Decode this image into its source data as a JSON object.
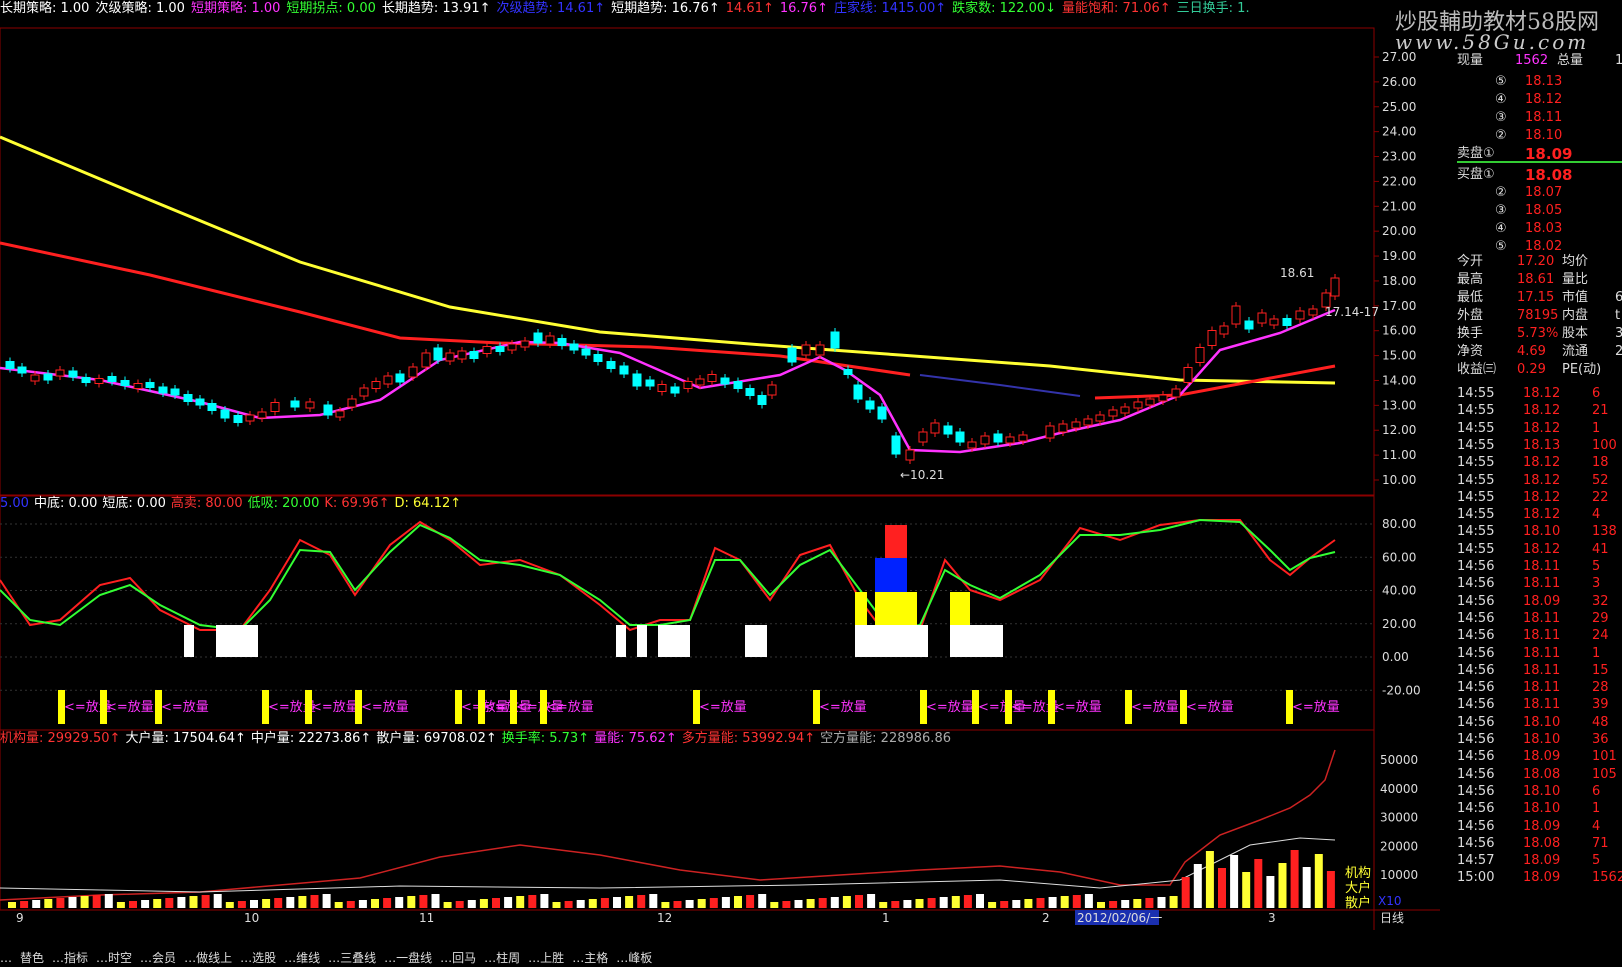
{
  "top_indicators": [
    {
      "label": "长期策略",
      "value": "1.00",
      "color": "#ffffff"
    },
    {
      "label": "次级策略",
      "value": "1.00",
      "color": "#ffffff"
    },
    {
      "label": "短期策略",
      "value": "1.00",
      "color": "#ff33ff"
    },
    {
      "label": "短期拐点",
      "value": "0.00",
      "color": "#33ff33"
    },
    {
      "label": "长期趋势",
      "value": "13.91↑",
      "color": "#ffffff"
    },
    {
      "label": "次级趋势",
      "value": "14.61↑",
      "color": "#3333ff"
    },
    {
      "label": "短期趋势",
      "value": "16.76↑",
      "color": "#ffffff"
    },
    {
      "label": "",
      "value": "14.61↑",
      "color": "#ff3333"
    },
    {
      "label": "",
      "value": "16.76↑",
      "color": "#ff33ff"
    },
    {
      "label": "庄家线",
      "value": "1415.00↑",
      "color": "#3333ff"
    },
    {
      "label": "跌家数",
      "value": "122.00↓",
      "color": "#33ff33"
    },
    {
      "label": "量能饱和",
      "value": "71.06↑",
      "color": "#ff3333"
    },
    {
      "label": "三日换手",
      "value": "1.",
      "color": "#33cc99"
    }
  ],
  "watermark": {
    "line1": "炒股輔助教材58股网",
    "line2": "www.58Gu.com"
  },
  "price_axis": [
    "27.00",
    "26.00",
    "25.00",
    "24.00",
    "23.00",
    "22.00",
    "21.00",
    "20.00",
    "19.00",
    "18.00",
    "17.00",
    "16.00",
    "15.00",
    "14.00",
    "13.00",
    "12.00",
    "11.00",
    "10.00"
  ],
  "kd_axis": [
    "80.00",
    "60.00",
    "40.00",
    "20.00",
    "0.00",
    "-20.00"
  ],
  "vol_axis": [
    "50000",
    "40000",
    "30000",
    "20000",
    "10000"
  ],
  "price_annotations": {
    "high": "18.61",
    "low": "←10.21",
    "range": "17.14-17"
  },
  "kd_header": [
    {
      "label": "中底",
      "value": "0.00",
      "color": "#ffffff"
    },
    {
      "label": "短底",
      "value": "0.00",
      "color": "#ffffff"
    },
    {
      "label": "高卖",
      "value": "80.00",
      "color": "#ff3333"
    },
    {
      "label": "低吸",
      "value": "20.00",
      "color": "#33ff33"
    },
    {
      "label": "K",
      "value": "69.96↑",
      "color": "#ff3333"
    },
    {
      "label": "D",
      "value": "64.12↑",
      "color": "#ffff33"
    }
  ],
  "kd_header_prefix": "5.00",
  "volume_label": "<=放量",
  "vol_header": [
    {
      "label": "机构量",
      "value": "29929.50↑",
      "color": "#ff3333"
    },
    {
      "label": "大户量",
      "value": "17504.64↑",
      "color": "#ffffff"
    },
    {
      "label": "中户量",
      "value": "22273.86↑",
      "color": "#ffffff"
    },
    {
      "label": "散户量",
      "value": "69708.02↑",
      "color": "#ffffff"
    },
    {
      "label": "换手率",
      "value": "5.73↑",
      "color": "#33ff33"
    },
    {
      "label": "量能",
      "value": "75.62↑",
      "color": "#ff33ff"
    },
    {
      "label": "多方量能",
      "value": "53992.94↑",
      "color": "#ff3333"
    },
    {
      "label": "空方量能",
      "value": "228986.86",
      "color": "#aaaaaa"
    }
  ],
  "vol_side_labels": [
    "机构",
    "大户",
    "散户"
  ],
  "vol_unit": "X10",
  "x_axis": [
    {
      "label": "9"
    },
    {
      "label": "10"
    },
    {
      "label": "11"
    },
    {
      "label": "12"
    },
    {
      "label": "1"
    },
    {
      "label": "2"
    },
    {
      "label": "2012/02/06/一"
    },
    {
      "label": "3"
    }
  ],
  "period_label": "日线",
  "bottom_tabs": [
    "…",
    "替色",
    "…指标",
    "…时空",
    "…会员",
    "…做线上",
    "…选股",
    "…维线",
    "…三叠线",
    "…一盘线",
    "…回马",
    "…柱周",
    "…上胜",
    "…主格",
    "…峰板"
  ],
  "quote": {
    "xianliang_label": "现量",
    "xianliang": "1562",
    "zongliang_label": "总量",
    "zongliang": "1",
    "sells": [
      {
        "n": "⑤",
        "p": "18.13"
      },
      {
        "n": "④",
        "p": "18.12"
      },
      {
        "n": "③",
        "p": "18.11"
      },
      {
        "n": "②",
        "p": "18.10"
      },
      {
        "n": "卖盘①",
        "p": "18.09"
      }
    ],
    "buys": [
      {
        "n": "买盘①",
        "p": "18.08"
      },
      {
        "n": "②",
        "p": "18.07"
      },
      {
        "n": "③",
        "p": "18.05"
      },
      {
        "n": "④",
        "p": "18.03"
      },
      {
        "n": "⑤",
        "p": "18.02"
      }
    ],
    "stats": [
      {
        "l": "今开",
        "v": "17.20",
        "l2": "均价",
        "v2": ""
      },
      {
        "l": "最高",
        "v": "18.61",
        "l2": "量比",
        "v2": ""
      },
      {
        "l": "最低",
        "v": "17.15",
        "l2": "市值",
        "v2": "6"
      },
      {
        "l": "外盘",
        "v": "78195",
        "l2": "内盘",
        "v2": "t"
      },
      {
        "l": "换手",
        "v": "5.73%",
        "l2": "股本",
        "v2": "3"
      },
      {
        "l": "净资",
        "v": "4.69",
        "l2": "流通",
        "v2": "2"
      },
      {
        "l": "收益㈢",
        "v": "0.29",
        "l2": "PE(动)",
        "v2": ""
      }
    ],
    "ticks": [
      {
        "t": "14:55",
        "p": "18.12",
        "v": "6"
      },
      {
        "t": "14:55",
        "p": "18.12",
        "v": "21"
      },
      {
        "t": "14:55",
        "p": "18.12",
        "v": "1"
      },
      {
        "t": "14:55",
        "p": "18.13",
        "v": "100"
      },
      {
        "t": "14:55",
        "p": "18.12",
        "v": "18"
      },
      {
        "t": "14:55",
        "p": "18.12",
        "v": "52"
      },
      {
        "t": "14:55",
        "p": "18.12",
        "v": "22"
      },
      {
        "t": "14:55",
        "p": "18.12",
        "v": "4"
      },
      {
        "t": "14:55",
        "p": "18.10",
        "v": "138"
      },
      {
        "t": "14:55",
        "p": "18.12",
        "v": "41"
      },
      {
        "t": "14:56",
        "p": "18.11",
        "v": "5"
      },
      {
        "t": "14:56",
        "p": "18.11",
        "v": "3"
      },
      {
        "t": "14:56",
        "p": "18.09",
        "v": "32"
      },
      {
        "t": "14:56",
        "p": "18.11",
        "v": "29"
      },
      {
        "t": "14:56",
        "p": "18.11",
        "v": "24"
      },
      {
        "t": "14:56",
        "p": "18.11",
        "v": "1"
      },
      {
        "t": "14:56",
        "p": "18.11",
        "v": "15"
      },
      {
        "t": "14:56",
        "p": "18.11",
        "v": "28"
      },
      {
        "t": "14:56",
        "p": "18.11",
        "v": "39"
      },
      {
        "t": "14:56",
        "p": "18.10",
        "v": "48"
      },
      {
        "t": "14:56",
        "p": "18.10",
        "v": "36"
      },
      {
        "t": "14:56",
        "p": "18.09",
        "v": "101"
      },
      {
        "t": "14:56",
        "p": "18.08",
        "v": "105"
      },
      {
        "t": "14:56",
        "p": "18.10",
        "v": "6"
      },
      {
        "t": "14:56",
        "p": "18.10",
        "v": "1"
      },
      {
        "t": "14:56",
        "p": "18.09",
        "v": "4"
      },
      {
        "t": "14:56",
        "p": "18.08",
        "v": "71"
      },
      {
        "t": "14:57",
        "p": "18.09",
        "v": "5"
      },
      {
        "t": "15:00",
        "p": "18.09",
        "v": "1562"
      }
    ]
  },
  "colors": {
    "up": "#ff2020",
    "down": "#00ffff",
    "ma_long": "#ffff33",
    "ma_mid": "#ff2020",
    "ma_short": "#ff33ff",
    "grid": "#8b0000"
  }
}
